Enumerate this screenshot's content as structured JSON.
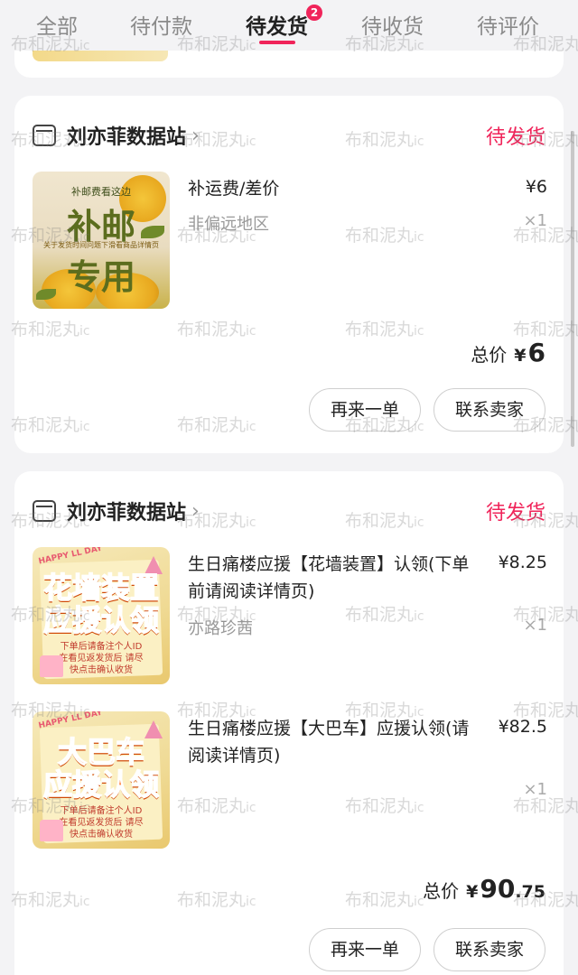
{
  "tabs": [
    {
      "label": "全部",
      "active": false
    },
    {
      "label": "待付款",
      "active": false
    },
    {
      "label": "待发货",
      "active": true,
      "badge": "2"
    },
    {
      "label": "待收货",
      "active": false
    },
    {
      "label": "待评价",
      "active": false
    }
  ],
  "accent_color": "#f0245a",
  "watermark": {
    "text": "布和泥丸",
    "suffix": "ic"
  },
  "orders": [
    {
      "shop_name": "刘亦菲数据站",
      "status": "待发货",
      "items": [
        {
          "title": "补运费/差价",
          "spec": "非偏远地区",
          "price": "¥6",
          "qty": "×1",
          "image": {
            "top_text": "补邮费看这边",
            "big_line1": "补邮",
            "sub_text": "关于发货时间问题下滑看商品详情页",
            "big_line2": "专用"
          }
        }
      ],
      "total_label": "总价",
      "total_currency": "¥",
      "total_int": "6",
      "total_dec": "",
      "buttons": {
        "rebuy": "再来一单",
        "contact": "联系卖家"
      }
    },
    {
      "shop_name": "刘亦菲数据站",
      "status": "待发货",
      "items": [
        {
          "title": "生日痛楼应援【花墙装置】认领(下单前请阅读详情页)",
          "spec": "亦路珍茜",
          "price": "¥8.25",
          "qty": "×1",
          "image": {
            "corner": "HAPPY LL DAY",
            "big_line1": "花墙装置",
            "big_line2": "应援认领",
            "note": "下单后请备注个人ID 在看见返发货后 请尽快点击确认收货"
          }
        },
        {
          "title": "生日痛楼应援【大巴车】应援认领(请阅读详情页)",
          "spec": "",
          "price": "¥82.5",
          "qty": "×1",
          "image": {
            "corner": "HAPPY LL DAY",
            "big_line1": "大巴车",
            "big_line2": "应援认领",
            "note": "下单后请备注个人ID 在看见返发货后 请尽快点击确认收货"
          }
        }
      ],
      "total_label": "总价",
      "total_currency": "¥",
      "total_int": "90",
      "total_dec": ".75",
      "buttons": {
        "rebuy": "再来一单",
        "contact": "联系卖家"
      }
    }
  ]
}
